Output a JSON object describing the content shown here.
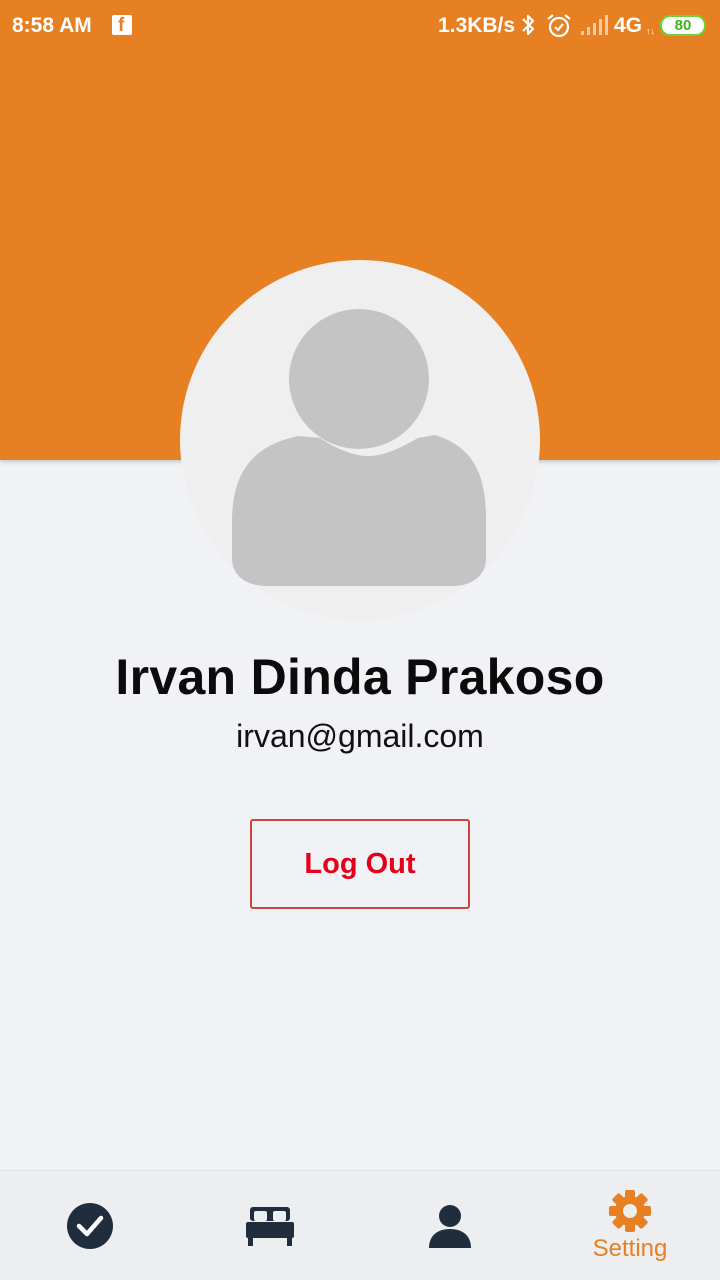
{
  "status_bar": {
    "time": "8:58 AM",
    "notification_icon": "facebook-icon",
    "net_speed": "1.3KB/s",
    "network_type": "4G",
    "network_sub": "↑↓",
    "battery_level": "80"
  },
  "profile": {
    "name": "Irvan Dinda Prakoso",
    "email": "irvan@gmail.com",
    "avatar_icon": "default-user-avatar"
  },
  "actions": {
    "logout_label": "Log Out"
  },
  "bottom_nav": {
    "active_index": 3,
    "items": [
      {
        "icon": "check-circle-icon",
        "label": ""
      },
      {
        "icon": "bed-icon",
        "label": ""
      },
      {
        "icon": "person-icon",
        "label": ""
      },
      {
        "icon": "gear-icon",
        "label": "Setting"
      }
    ]
  },
  "colors": {
    "header": "#e68022",
    "background": "#f0f2f5",
    "nav_icon": "#1f2d3d",
    "nav_active": "#e68022",
    "logout_text": "#e4001a",
    "logout_border": "#d3433e",
    "battery": "#6bd33b"
  }
}
